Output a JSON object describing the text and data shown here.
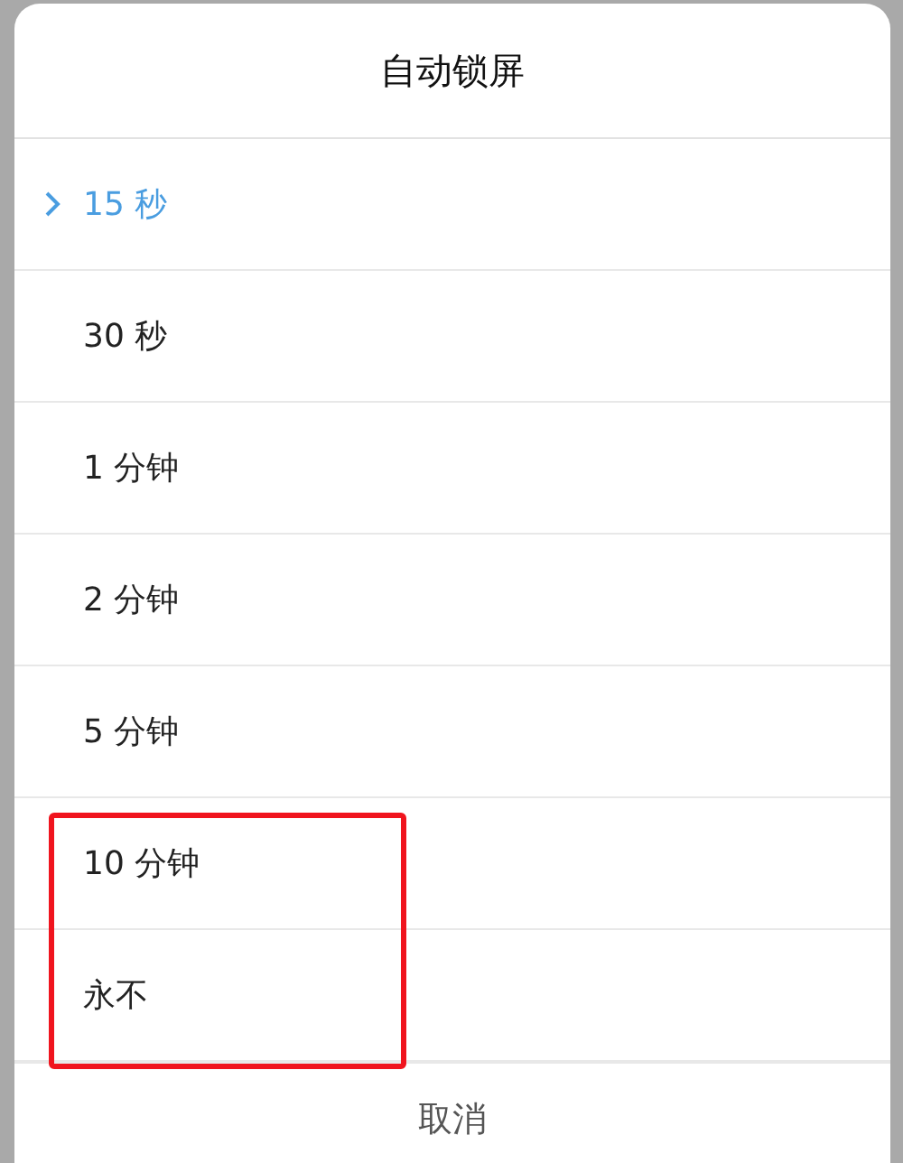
{
  "dialog": {
    "title": "自动锁屏",
    "options": [
      {
        "label": "15 秒",
        "selected": true,
        "highlighted": false
      },
      {
        "label": "30 秒",
        "selected": false,
        "highlighted": false
      },
      {
        "label": "1 分钟",
        "selected": false,
        "highlighted": false
      },
      {
        "label": "2 分钟",
        "selected": false,
        "highlighted": false
      },
      {
        "label": "5 分钟",
        "selected": false,
        "highlighted": false
      },
      {
        "label": "10 分钟",
        "selected": false,
        "highlighted": true
      },
      {
        "label": "永不",
        "selected": false,
        "highlighted": true
      }
    ],
    "cancel_button": "取消"
  }
}
